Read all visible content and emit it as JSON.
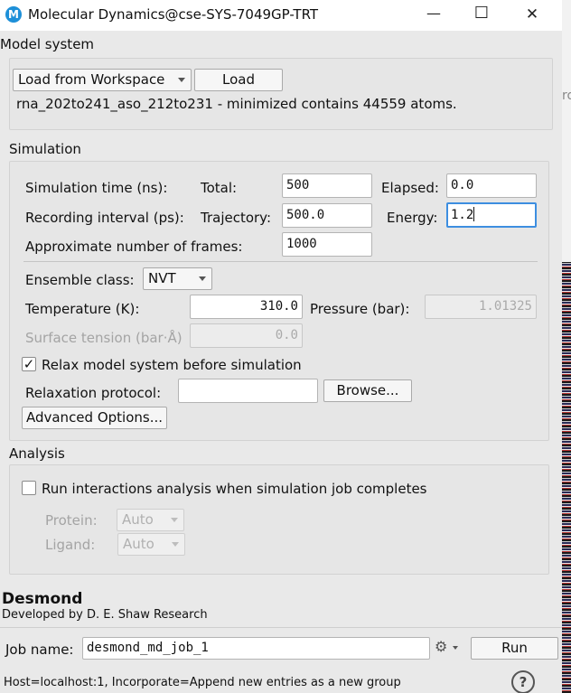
{
  "window": {
    "title": "Molecular Dynamics@cse-SYS-7049GP-TRT",
    "icon_letter": "M",
    "minimize": "—",
    "maximize": "☐",
    "close": "✕"
  },
  "model_system": {
    "title": "Model system",
    "source_value": "Load from Workspace",
    "load_label": "Load",
    "info": "rna_202to241_aso_212to231 - minimized contains 44559 atoms."
  },
  "simulation": {
    "title": "Simulation",
    "sim_time_label": "Simulation time (ns):",
    "total_label": "Total:",
    "total_value": "500",
    "elapsed_label": "Elapsed:",
    "elapsed_value": "0.0",
    "rec_interval_label": "Recording interval (ps):",
    "trajectory_label": "Trajectory:",
    "trajectory_value": "500.0",
    "energy_label": "Energy:",
    "energy_value": "1.2",
    "frames_label": "Approximate number of frames:",
    "frames_value": "1000",
    "ensemble_label": "Ensemble class:",
    "ensemble_value": "NVT",
    "temperature_label": "Temperature (K):",
    "temperature_value": "310.0",
    "pressure_label": "Pressure (bar):",
    "pressure_value": "1.01325",
    "surface_tension_label": "Surface tension (bar·Å)",
    "surface_tension_value": "0.0",
    "relax_label": "Relax model system before simulation",
    "relax_checked": true,
    "relax_protocol_label": "Relaxation protocol:",
    "relax_protocol_value": "",
    "browse_label": "Browse...",
    "advanced_label": "Advanced Options..."
  },
  "analysis": {
    "title": "Analysis",
    "run_interactions_label": "Run interactions analysis when simulation job completes",
    "run_interactions_checked": false,
    "protein_label": "Protein:",
    "protein_value": "Auto",
    "ligand_label": "Ligand:",
    "ligand_value": "Auto"
  },
  "footer": {
    "brand": "Desmond",
    "developer": "Developed by D. E. Shaw Research",
    "job_name_label": "Job name:",
    "job_name_value": "desmond_md_job_1",
    "settings_icon": "⚙",
    "run_label": "Run",
    "status": "Host=localhost:1, Incorporate=Append new entries as a new group",
    "help_icon": "?"
  }
}
